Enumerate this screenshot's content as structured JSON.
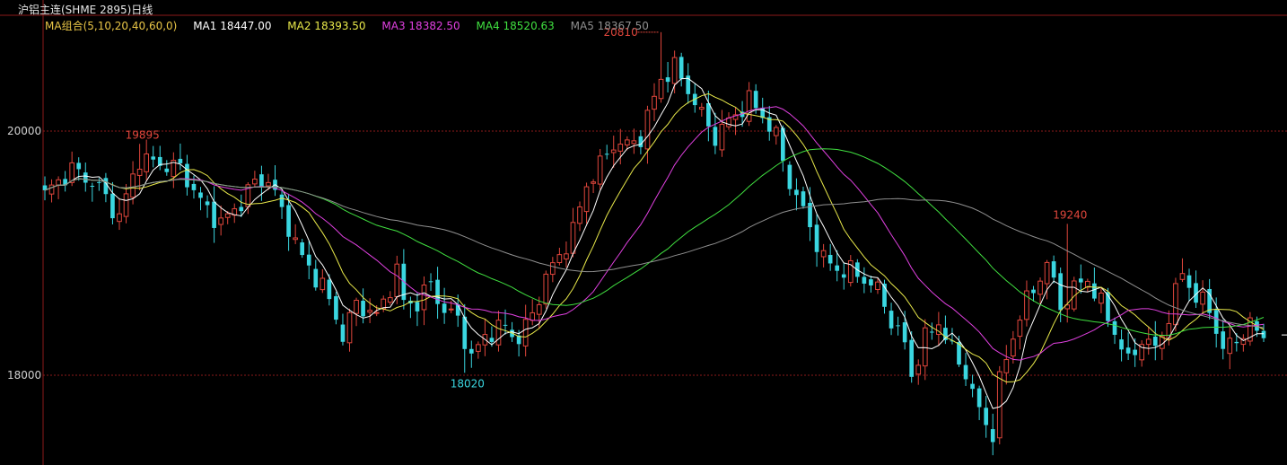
{
  "header": {
    "title": "沪铝主连(SHME 2895)日线"
  },
  "legend": {
    "items": [
      {
        "text": "MA组合(5,10,20,40,60,0)",
        "color": "#e8c547"
      },
      {
        "text": "MA1 18447.00",
        "color": "#ffffff"
      },
      {
        "text": "MA2 18393.50",
        "color": "#e8e84a"
      },
      {
        "text": "MA3 18382.50",
        "color": "#e040e0"
      },
      {
        "text": "MA4 18520.63",
        "color": "#40e040"
      },
      {
        "text": "MA5 18367.50",
        "color": "#909090"
      }
    ]
  },
  "colors": {
    "up": "#e0463c",
    "down": "#3ad6e0",
    "grid": "#8b1a1a",
    "axis_text": "#d0d0d0",
    "ma1": "#ffffff",
    "ma2": "#e8e84a",
    "ma3": "#e040e0",
    "ma4": "#40e040",
    "ma5": "#909090"
  },
  "chart_data": {
    "type": "candlestick",
    "title": "沪铝主连(SHME 2895)日线",
    "y_ticks": [
      18000,
      20000
    ],
    "ylim": [
      17300,
      20950
    ],
    "grid": true,
    "annotations": [
      {
        "text": "19895",
        "index": 14,
        "value": 19895,
        "kind": "high"
      },
      {
        "text": "18020",
        "index": 62,
        "value": 18020,
        "kind": "low"
      },
      {
        "text": "20810",
        "index": 91,
        "value": 20810,
        "kind": "high",
        "arrow": true
      },
      {
        "text": "19240",
        "index": 151,
        "value": 19240,
        "kind": "high"
      }
    ],
    "current_price": 18330,
    "anchors": [
      [
        0,
        19480
      ],
      [
        4,
        19690
      ],
      [
        8,
        19540
      ],
      [
        9,
        19440
      ],
      [
        11,
        19300
      ],
      [
        14,
        19780
      ],
      [
        16,
        19740
      ],
      [
        20,
        19700
      ],
      [
        23,
        19420
      ],
      [
        26,
        19240
      ],
      [
        29,
        19420
      ],
      [
        31,
        19580
      ],
      [
        33,
        19600
      ],
      [
        36,
        19220
      ],
      [
        38,
        18960
      ],
      [
        41,
        18730
      ],
      [
        43,
        18480
      ],
      [
        44,
        18320
      ],
      [
        46,
        18590
      ],
      [
        49,
        18480
      ],
      [
        52,
        18850
      ],
      [
        53,
        18600
      ],
      [
        55,
        18590
      ],
      [
        57,
        18750
      ],
      [
        59,
        18520
      ],
      [
        61,
        18470
      ],
      [
        63,
        18130
      ],
      [
        65,
        18330
      ],
      [
        68,
        18400
      ],
      [
        70,
        18290
      ],
      [
        72,
        18500
      ],
      [
        74,
        18800
      ],
      [
        76,
        18980
      ],
      [
        78,
        19180
      ],
      [
        80,
        19560
      ],
      [
        82,
        19720
      ],
      [
        84,
        19900
      ],
      [
        86,
        19880
      ],
      [
        88,
        19950
      ],
      [
        91,
        20430
      ],
      [
        93,
        20520
      ],
      [
        95,
        20340
      ],
      [
        97,
        20130
      ],
      [
        99,
        19950
      ],
      [
        101,
        20080
      ],
      [
        104,
        20250
      ],
      [
        106,
        20130
      ],
      [
        108,
        19950
      ],
      [
        110,
        19580
      ],
      [
        113,
        19220
      ],
      [
        115,
        18950
      ],
      [
        117,
        18870
      ],
      [
        119,
        18850
      ],
      [
        121,
        18790
      ],
      [
        123,
        18700
      ],
      [
        125,
        18450
      ],
      [
        127,
        18250
      ],
      [
        128,
        18000
      ],
      [
        130,
        18300
      ],
      [
        132,
        18440
      ],
      [
        134,
        18200
      ],
      [
        136,
        18020
      ],
      [
        138,
        17700
      ],
      [
        140,
        17520
      ],
      [
        141,
        17950
      ],
      [
        144,
        18500
      ],
      [
        146,
        18700
      ],
      [
        148,
        18920
      ],
      [
        150,
        18560
      ],
      [
        152,
        18710
      ],
      [
        154,
        18790
      ],
      [
        156,
        18580
      ],
      [
        158,
        18360
      ],
      [
        160,
        18100
      ],
      [
        162,
        18300
      ],
      [
        164,
        18210
      ],
      [
        166,
        18480
      ],
      [
        168,
        18850
      ],
      [
        170,
        18630
      ],
      [
        172,
        18550
      ],
      [
        174,
        18200
      ],
      [
        176,
        18300
      ],
      [
        178,
        18400
      ],
      [
        180,
        18330
      ]
    ]
  }
}
